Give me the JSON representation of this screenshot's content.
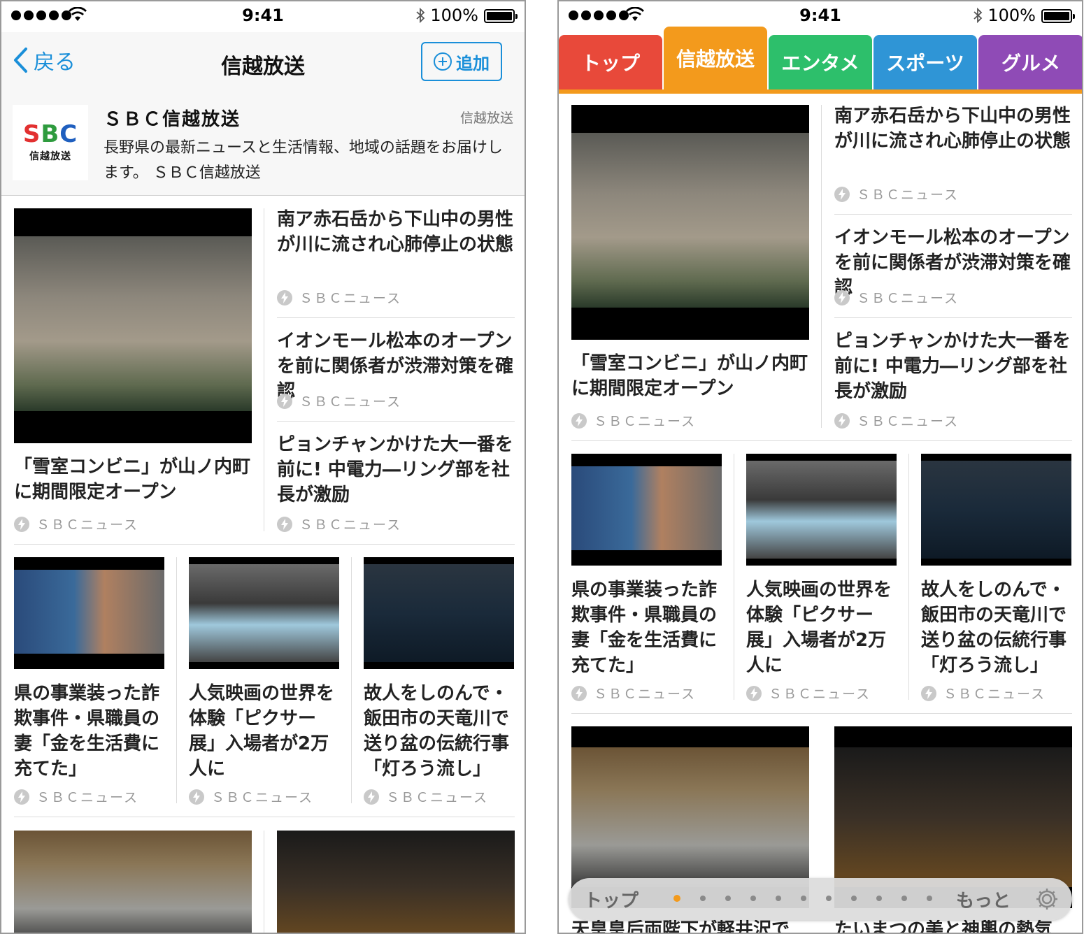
{
  "status": {
    "time": "9:41",
    "battery": "100%"
  },
  "left": {
    "nav": {
      "back": "戻る",
      "title": "信越放送",
      "add": "追加"
    },
    "channel": {
      "logo_text": [
        "S",
        "B",
        "C"
      ],
      "logo_sub": "信越放送",
      "name": "ＳＢＣ信越放送",
      "tag": "信越放送",
      "description": "長野県の最新ニュースと生活情報、地域の話題をお届けします。 ＳＢＣ信越放送"
    }
  },
  "right": {
    "tabs": [
      {
        "label": "トップ",
        "color": "#e8493a"
      },
      {
        "label": "信越放送",
        "color": "#f39a1c"
      },
      {
        "label": "エンタメ",
        "color": "#2dbf6b"
      },
      {
        "label": "スポーツ",
        "color": "#2f95d6"
      },
      {
        "label": "グルメ",
        "color": "#8f4bb6"
      }
    ],
    "pager": {
      "left": "トップ",
      "right": "もっと",
      "pages": 11,
      "active_page": 1
    }
  },
  "articles": {
    "main": {
      "title": "「雪室コンビニ」が山ノ内町に期間限定オープン",
      "source": "ＳＢＣニュース"
    },
    "side": [
      {
        "title": "南ア赤石岳から下山中の男性が川に流され心肺停止の状態",
        "source": "ＳＢＣニュース"
      },
      {
        "title": "イオンモール松本のオープンを前に関係者が渋滞対策を確認",
        "source": "ＳＢＣニュース"
      },
      {
        "title": "ピョンチャンかけた大一番を前に! 中電力―リング部を社長が激励",
        "source": "ＳＢＣニュース"
      }
    ],
    "row": [
      {
        "title": "県の事業装った詐欺事件・県職員の妻「金を生活費に充てた」",
        "source": "ＳＢＣニュース"
      },
      {
        "title": "人気映画の世界を体験「ピクサー展」入場者が2万人に",
        "source": "ＳＢＣニュース"
      },
      {
        "title": "故人をしのんで・飯田市の天竜川で送り盆の伝統行事「灯ろう流し」",
        "source": "ＳＢＣニュース"
      }
    ],
    "bottom_partial": [
      {
        "title": "天皇皇后両陛下が軽井沢で"
      },
      {
        "title": "たいまつの美と神輿の熱気"
      }
    ]
  },
  "colors": {
    "accent_blue": "#1a8fd9",
    "tab_underline": "#f39a1c"
  }
}
